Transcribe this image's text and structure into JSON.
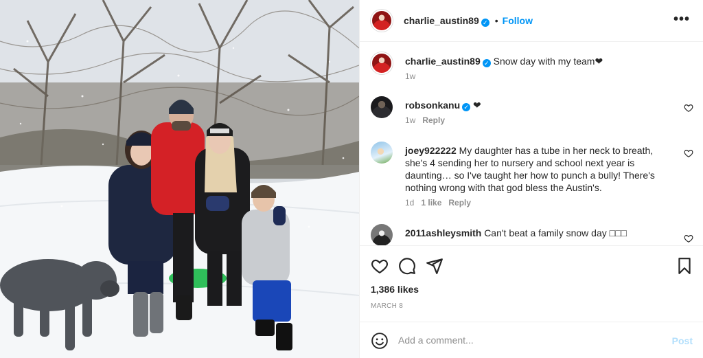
{
  "post": {
    "author": "charlie_austin89",
    "follow_label": "Follow",
    "separator": "•",
    "more_label": "•••",
    "verified_mark": "✓"
  },
  "comments": [
    {
      "user": "charlie_austin89",
      "verified": true,
      "text": "Snow day with my team❤",
      "time": "1w",
      "likes": "",
      "reply": ""
    },
    {
      "user": "robsonkanu",
      "verified": true,
      "text": "❤",
      "time": "1w",
      "likes": "",
      "reply": "Reply"
    },
    {
      "user": "joey922222",
      "verified": false,
      "text": "My daughter has a tube in her neck to breath, she's 4 sending her to nursery and school next year is daunting… so I've taught her how to punch a bully! There's nothing wrong with that god bless the Austin's.",
      "time": "1d",
      "likes": "1 like",
      "reply": "Reply"
    },
    {
      "user": "2011ashleysmith",
      "verified": false,
      "text": "Can't beat a family snow day □□□",
      "time": "",
      "likes": "",
      "reply": ""
    }
  ],
  "actions": {
    "likes_label": "1,386 likes",
    "date": "MARCH 8"
  },
  "add_comment": {
    "placeholder": "Add a comment...",
    "post_label": "Post"
  },
  "icons": {
    "like": "heart-icon",
    "comment": "comment-bubble-icon",
    "share": "paper-plane-icon",
    "save": "bookmark-icon",
    "more": "more-options-icon",
    "emoji": "smiley-icon",
    "comment_like": "heart-small-icon"
  },
  "colors": {
    "accent": "#0095f6",
    "post_disabled": "#b2dffc",
    "muted": "#8e8e8e",
    "text": "#262626"
  }
}
